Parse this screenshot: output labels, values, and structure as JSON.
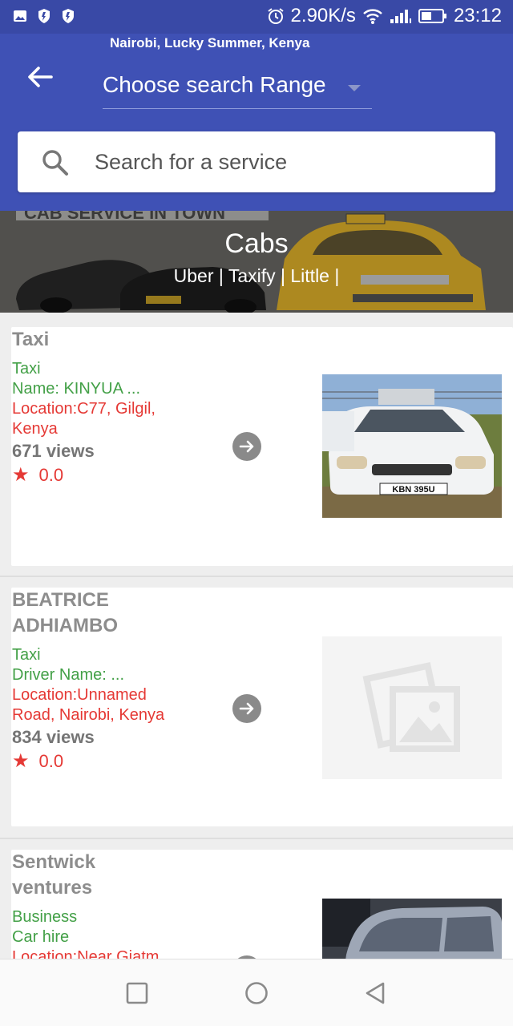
{
  "status_bar": {
    "left_icons": [
      "image-icon",
      "shield-icon",
      "shield-icon"
    ],
    "speed": "2.90K/s",
    "time": "23:12"
  },
  "header": {
    "location": "Nairobi, Lucky Summer, Kenya",
    "range_label": "Choose search Range"
  },
  "search": {
    "placeholder": "Search for a service"
  },
  "banner": {
    "image_text": "CAB SERVICE IN TOWN",
    "title": "Cabs",
    "subtitle": "Uber | Taxify | Little |"
  },
  "listings": [
    {
      "title": "Taxi",
      "category": "Taxi",
      "name_line": "Name: KINYUA ...",
      "location": "Location:C77, Gilgil, Kenya",
      "views": "671 views",
      "rating": "0.0",
      "plate": "KBN 395U"
    },
    {
      "title": "BEATRICE ADHIAMBO",
      "category": "Taxi",
      "name_line": "Driver Name: ...",
      "location": "Location:Unnamed Road, Nairobi, Kenya",
      "views": "834 views",
      "rating": "0.0"
    },
    {
      "title": "Sentwick ventures",
      "category": "Business",
      "name_line": "Car hire",
      "location": "Location:Near Giatm"
    }
  ],
  "colors": {
    "primary": "#3f51b5",
    "status_bar": "#3949a6",
    "green_text": "#43a047",
    "red_text": "#e53935"
  }
}
